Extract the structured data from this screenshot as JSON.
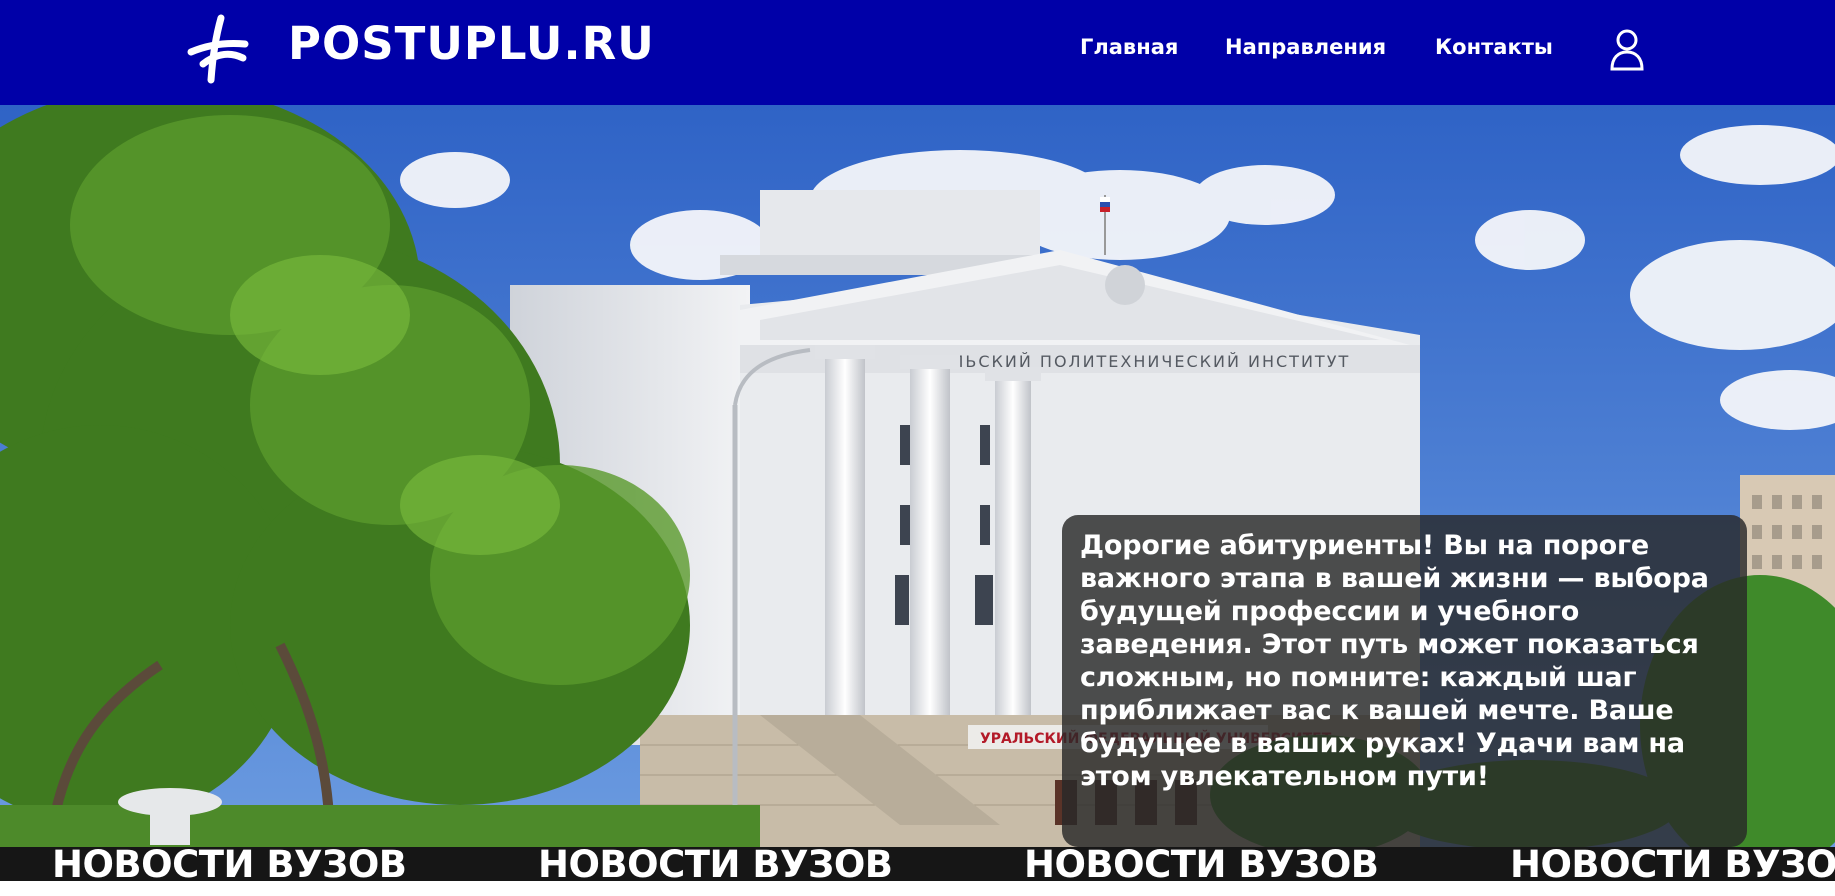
{
  "header": {
    "brand": "POSTUPLU.RU",
    "logo_icon": "crossed-pencil-logo",
    "nav": [
      "Главная",
      "Направления",
      "Контакты"
    ],
    "user_icon": "user-icon",
    "background_color": "#0000a8"
  },
  "hero": {
    "message": "Дорогие абитуриенты! Вы на пороге важного этапа в вашей жизни — выбора будущей профессии и учебного заведения. Этот путь может показаться сложным, но помните: каждый шаг приближает вас к вашей мечте. Ваше будущее в ваших руках! Удачи вам на этом увлекательном пути!",
    "building_sign": "УРАЛЬСКИЙ ПОЛИТЕХНИЧЕСКИЙ ИНСТИТУТ",
    "building_lower_sign": "УРАЛЬСКИЙ ФЕДЕРАЛЬНЫЙ УНИВЕРСИТЕТ"
  },
  "ticker": {
    "items": [
      "НОВОСТИ ВУЗОВ",
      "НОВОСТИ ВУЗОВ",
      "НОВОСТИ ВУЗОВ",
      "НОВОСТИ ВУЗОВ"
    ]
  }
}
